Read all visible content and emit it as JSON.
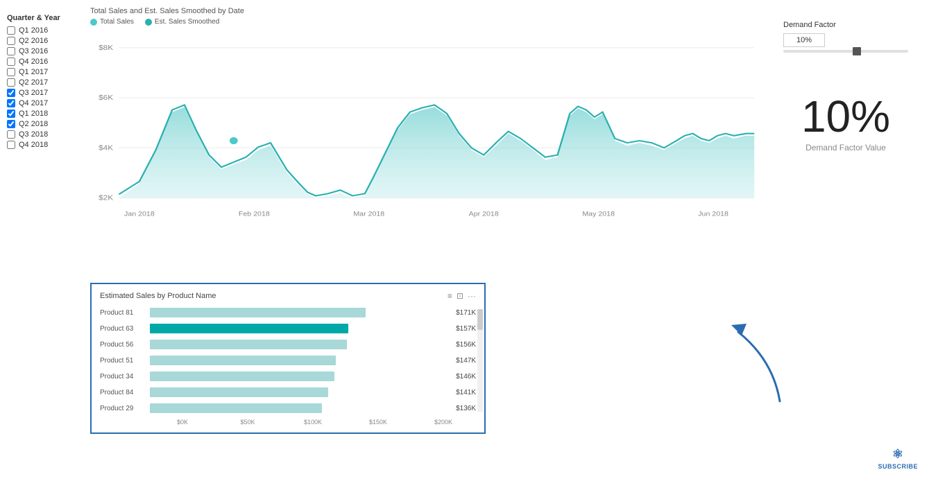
{
  "sidebar": {
    "title": "Quarter & Year",
    "items": [
      {
        "label": "Q1 2016",
        "checked": false
      },
      {
        "label": "Q2 2016",
        "checked": false
      },
      {
        "label": "Q3 2016",
        "checked": false
      },
      {
        "label": "Q4 2016",
        "checked": false
      },
      {
        "label": "Q1 2017",
        "checked": false
      },
      {
        "label": "Q2 2017",
        "checked": false
      },
      {
        "label": "Q3 2017",
        "checked": true
      },
      {
        "label": "Q4 2017",
        "checked": true
      },
      {
        "label": "Q1 2018",
        "checked": true
      },
      {
        "label": "Q2 2018",
        "checked": true
      },
      {
        "label": "Q3 2018",
        "checked": false
      },
      {
        "label": "Q4 2018",
        "checked": false
      }
    ]
  },
  "top_chart": {
    "title": "Total Sales and Est. Sales Smoothed by Date",
    "legend": [
      {
        "label": "Total Sales",
        "color": "#4dc9c9"
      },
      {
        "label": "Est. Sales Smoothed",
        "color": "#2ab0b0"
      }
    ],
    "y_labels": [
      "$8K",
      "$6K",
      "$4K",
      "$2K"
    ],
    "x_labels": [
      "Jan 2018",
      "Feb 2018",
      "Mar 2018",
      "Apr 2018",
      "May 2018",
      "Jun 2018"
    ]
  },
  "bar_chart": {
    "title": "Estimated Sales by Product Name",
    "bars": [
      {
        "label": "Product 81",
        "value": 171000,
        "display": "$171K",
        "pct": 85.5,
        "highlighted": false
      },
      {
        "label": "Product 63",
        "value": 157000,
        "display": "$157K",
        "pct": 78.5,
        "highlighted": true
      },
      {
        "label": "Product 56",
        "value": 156000,
        "display": "$156K",
        "pct": 78,
        "highlighted": false
      },
      {
        "label": "Product 51",
        "value": 147000,
        "display": "$147K",
        "pct": 73.5,
        "highlighted": false
      },
      {
        "label": "Product 34",
        "value": 146000,
        "display": "$146K",
        "pct": 73,
        "highlighted": false
      },
      {
        "label": "Product 84",
        "value": 141000,
        "display": "$141K",
        "pct": 70.5,
        "highlighted": false
      },
      {
        "label": "Product 29",
        "value": 136000,
        "display": "$136K",
        "pct": 68,
        "highlighted": false
      }
    ],
    "x_axis_labels": [
      "$0K",
      "$50K",
      "$100K",
      "$150K",
      "$200K"
    ],
    "normal_color": "#a8d8d8",
    "highlight_color": "#00a8a8"
  },
  "demand_factor": {
    "label": "Demand Factor",
    "slider_value": "10%",
    "big_value": "10%",
    "sub_label": "Demand Factor Value"
  },
  "subscribe": {
    "label": "SUBSCRIBE"
  }
}
